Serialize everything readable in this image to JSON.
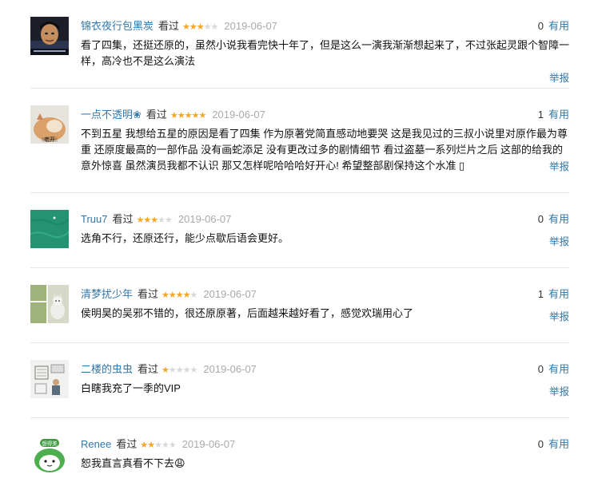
{
  "comments": [
    {
      "user": "锦衣夜行包黑炭",
      "status": "看过",
      "rating": 3,
      "date": "2019-06-07",
      "votes": "0",
      "useful": "有用",
      "text": "看了四集，还挺还原的，虽然小说我看完快十年了，但是这么一演我渐渐想起来了，不过张起灵跟个智障一样，高冷也不是这么演法",
      "report": "举报",
      "avatar_icon": "man-portrait-avatar"
    },
    {
      "user": "一点不透明",
      "user_icon": "❀",
      "status": "看过",
      "rating": 5,
      "date": "2019-06-07",
      "votes": "1",
      "useful": "有用",
      "text": "不到五星 我想给五星的原因是看了四集 作为原著党简直感动地要哭 这是我见过的三叔小说里对原作最为尊重 还原度最高的一部作品 没有画蛇添足 没有更改过多的剧情细节 看过盗墓一系列烂片之后 这部的给我的意外惊喜 虽然演员我都不认识 那又怎样呢哈哈哈好开心! 希望整部剧保持这个水准 ▯",
      "report": "举报",
      "avatar_icon": "cat-avatar",
      "avatar_text": "老开"
    },
    {
      "user": "Truu7",
      "status": "看过",
      "rating": 3,
      "date": "2019-06-07",
      "votes": "0",
      "useful": "有用",
      "text": "选角不行，还原还行，能少点歇后语会更好。",
      "report": "举报",
      "avatar_icon": "green-water-avatar"
    },
    {
      "user": "清梦扰少年",
      "status": "看过",
      "rating": 4,
      "date": "2019-06-07",
      "votes": "1",
      "useful": "有用",
      "text": "侯明昊的吴邪不错的，很还原原著，后面越来越好看了，感觉欢瑞用心了",
      "report": "举报",
      "avatar_icon": "window-cat-avatar"
    },
    {
      "user": "二楼的虫虫",
      "status": "看过",
      "rating": 1,
      "date": "2019-06-07",
      "votes": "0",
      "useful": "有用",
      "text": "白瞎我充了一季的VIP",
      "report": "举报",
      "avatar_icon": "sketch-avatar"
    },
    {
      "user": "Renee",
      "status": "看过",
      "rating": 2,
      "date": "2019-06-07",
      "votes": "0",
      "useful": "有用",
      "text": "恕我直言真看不下去😩",
      "report": "举报",
      "avatar_icon": "green-cartoon-avatar",
      "avatar_text": "想得美"
    }
  ]
}
